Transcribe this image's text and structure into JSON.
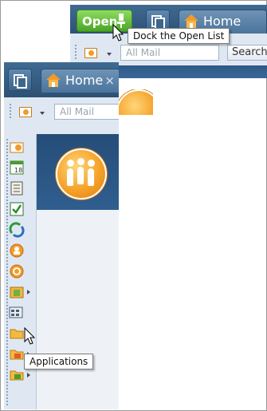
{
  "top_window": {
    "open_button_label": "Open",
    "home_tab_label": "Home",
    "tab_close_glyph": "×",
    "search_placeholder": "All Mail",
    "search_button_label": "Search"
  },
  "dock_tooltip": "Dock the Open List",
  "front_window": {
    "home_tab_label": "Home",
    "tab_close_glyph": "×",
    "search_placeholder": "All Mail"
  },
  "sidebar": {
    "items": [
      {
        "icon": "mail-icon",
        "has_menu": false
      },
      {
        "icon": "calendar-icon",
        "has_menu": false,
        "badge": "18"
      },
      {
        "icon": "contacts-icon",
        "has_menu": false
      },
      {
        "icon": "todo-icon",
        "has_menu": false
      },
      {
        "icon": "replication-icon",
        "has_menu": false
      },
      {
        "icon": "sametime-contacts-icon",
        "has_menu": false
      },
      {
        "icon": "sametime-icon",
        "has_menu": false
      },
      {
        "icon": "activities-icon",
        "has_menu": true
      },
      {
        "icon": "applications-icon",
        "has_menu": false
      },
      {
        "icon": "folder-icon",
        "has_menu": false
      },
      {
        "icon": "feeds-icon",
        "has_menu": true
      },
      {
        "icon": "workspace-icon",
        "has_menu": true
      }
    ]
  },
  "applications_tooltip": "Applications",
  "colors": {
    "open_green": "#5cb832",
    "tab_blue": "#3f6a93",
    "toolbar_bg": "#dfe8f2",
    "brand_orange": "#f5a22a"
  }
}
